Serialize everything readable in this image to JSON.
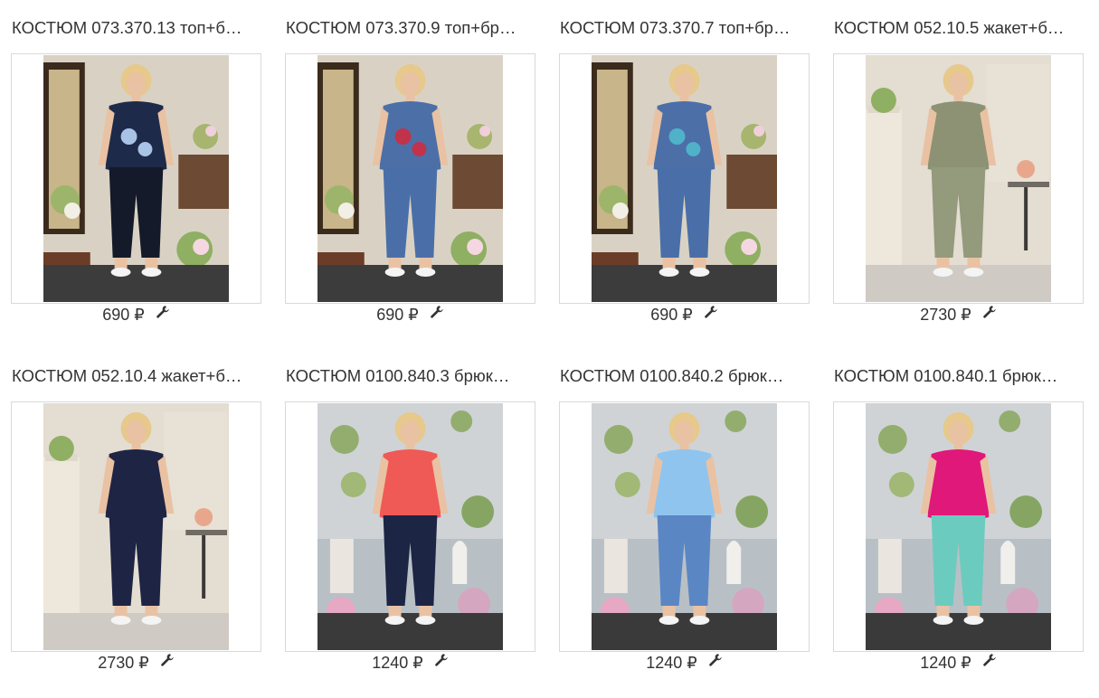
{
  "products": [
    {
      "title": "КОСТЮМ 073.370.13 топ+б…",
      "price": "690 ₽",
      "image": {
        "bg": "#d9d2c4",
        "floor": "#3c3c3c",
        "top": "#1e2a4a",
        "top_accent": "#a9c3e6",
        "bottom": "#141a2a",
        "skin": "#e9c2a3",
        "hair": "#e6c98b",
        "scene": "mirror"
      }
    },
    {
      "title": "КОСТЮМ 073.370.9 топ+бр…",
      "price": "690 ₽",
      "image": {
        "bg": "#d9d2c4",
        "floor": "#3c3c3c",
        "top": "#4c6fa8",
        "top_accent": "#c0334a",
        "bottom": "#4a6fa8",
        "skin": "#e9c2a3",
        "hair": "#e6c98b",
        "scene": "mirror"
      }
    },
    {
      "title": "КОСТЮМ 073.370.7 топ+бр…",
      "price": "690 ₽",
      "image": {
        "bg": "#d9d2c4",
        "floor": "#3c3c3c",
        "top": "#4c6fa8",
        "top_accent": "#4fb2c8",
        "bottom": "#4a6fa8",
        "skin": "#e9c2a3",
        "hair": "#e6c98b",
        "scene": "mirror"
      }
    },
    {
      "title": "КОСТЮМ 052.10.5 жакет+б…",
      "price": "2730 ₽",
      "image": {
        "bg": "#e4ddd2",
        "floor": "#cfcac3",
        "top": "#8c9273",
        "top_accent": "#8c9273",
        "bottom": "#949a7c",
        "skin": "#e9c2a3",
        "hair": "#e6c98b",
        "scene": "studio"
      }
    },
    {
      "title": "КОСТЮМ 052.10.4 жакет+б…",
      "price": "2730 ₽",
      "image": {
        "bg": "#e4ddd2",
        "floor": "#cfcac3",
        "top": "#1e2444",
        "top_accent": "#1e2444",
        "bottom": "#1e2444",
        "skin": "#e9c2a3",
        "hair": "#e6c98b",
        "scene": "studio"
      }
    },
    {
      "title": "КОСТЮМ 0100.840.3 брюк…",
      "price": "1240 ₽",
      "image": {
        "bg": "#b8c0c6",
        "floor": "#3a3a3a",
        "top": "#ef5a56",
        "top_accent": "#ef5a56",
        "bottom": "#1d2545",
        "skin": "#e9c2a3",
        "hair": "#e6c98b",
        "scene": "garden"
      }
    },
    {
      "title": "КОСТЮМ 0100.840.2 брюк…",
      "price": "1240 ₽",
      "image": {
        "bg": "#b8c0c6",
        "floor": "#3a3a3a",
        "top": "#8fc4ef",
        "top_accent": "#8fc4ef",
        "bottom": "#5a86c4",
        "skin": "#e9c2a3",
        "hair": "#e6c98b",
        "scene": "garden"
      }
    },
    {
      "title": "КОСТЮМ 0100.840.1 брюк…",
      "price": "1240 ₽",
      "image": {
        "bg": "#b8c0c6",
        "floor": "#3a3a3a",
        "top": "#e0187a",
        "top_accent": "#e0187a",
        "bottom": "#6ccbbf",
        "skin": "#e9c2a3",
        "hair": "#e6c98b",
        "scene": "garden"
      }
    }
  ],
  "icons": {
    "edit": "wrench-icon"
  },
  "colors": {
    "text": "#333333",
    "border": "#d9d9d9",
    "background": "#ffffff"
  }
}
